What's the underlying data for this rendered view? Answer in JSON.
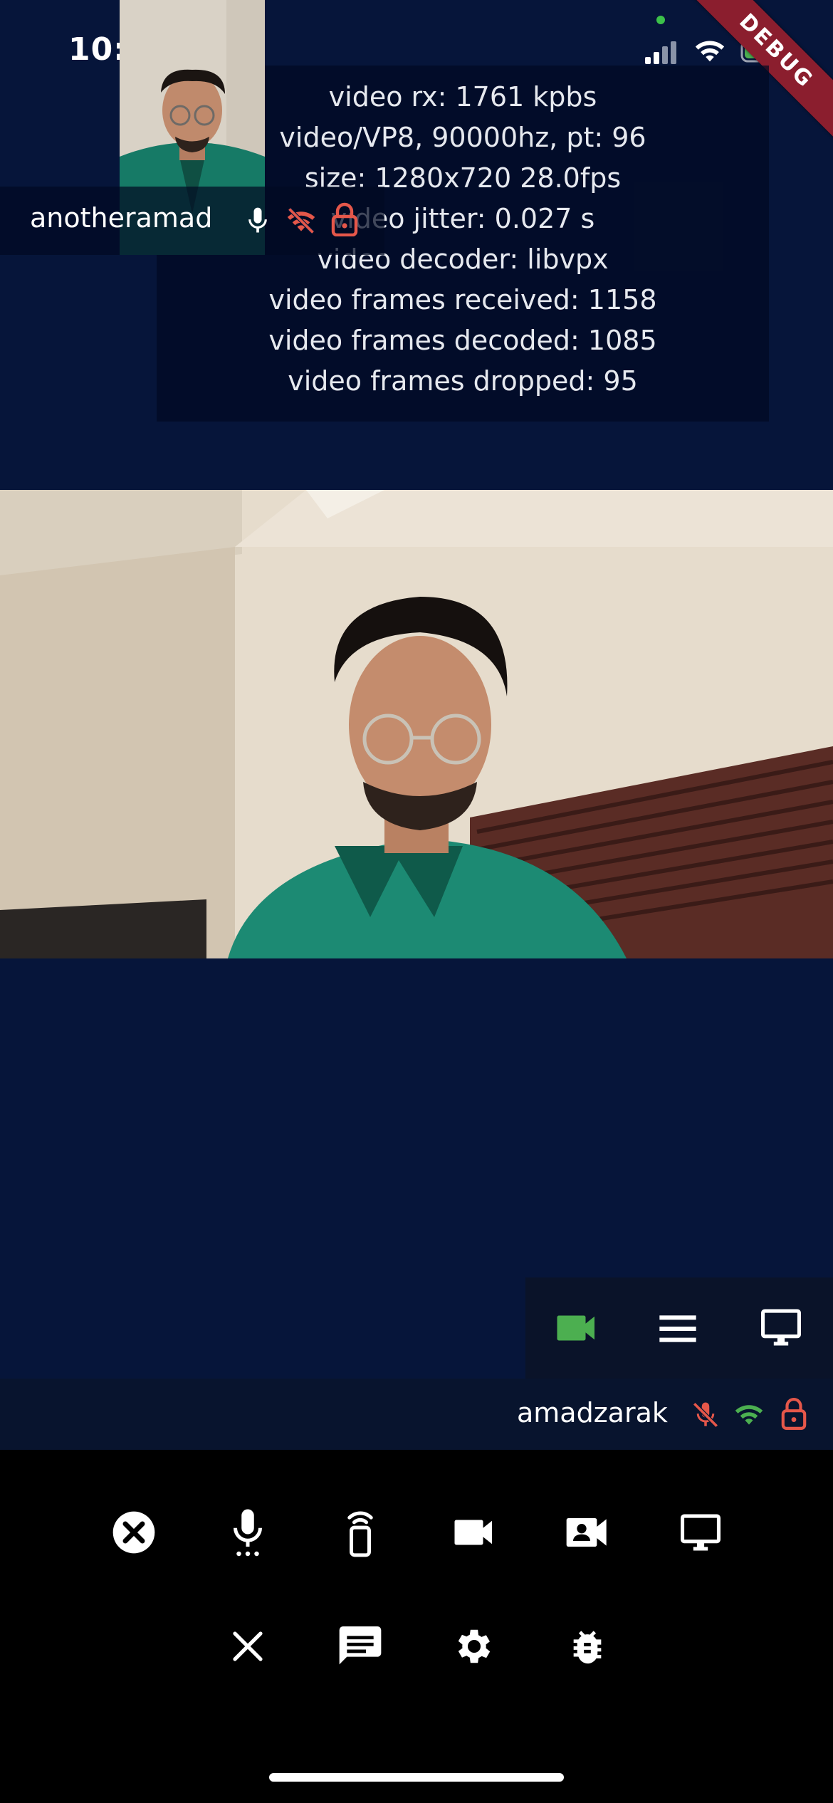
{
  "status_bar": {
    "time": "10:27",
    "icons": [
      "signal-icon",
      "wifi-icon",
      "battery-charging-icon"
    ]
  },
  "debug_banner": "DEBUG",
  "stats": {
    "lines": [
      "video rx: 1761 kpbs",
      "video/VP8, 90000hz, pt: 96",
      "size: 1280x720 28.0fps",
      "video jitter: 0.027 s",
      "video decoder: libvpx",
      "video frames received: 1158",
      "video frames decoded: 1085",
      "video frames dropped: 95"
    ]
  },
  "remote_participant": {
    "name": "anotheramad",
    "icons": [
      "mic-icon",
      "wifi-off-icon",
      "lock-open-icon"
    ]
  },
  "local_participant": {
    "name": "amadzarak",
    "icons": [
      "mic-off-icon",
      "wifi-icon",
      "lock-open-icon"
    ]
  },
  "view_switcher": {
    "items": [
      "videocam-icon",
      "menu-icon",
      "monitor-icon"
    ]
  },
  "controls": {
    "row1": [
      "close-circle-icon",
      "mic-icon",
      "speakerphone-icon",
      "videocam-icon",
      "switch-camera-icon",
      "screen-share-icon"
    ],
    "row2": [
      "close-icon",
      "chat-icon",
      "settings-icon",
      "debug-bug-icon"
    ]
  },
  "colors": {
    "background": "#06153a",
    "accent_green": "#4caf50",
    "warning_red": "#e5574a",
    "debug_banner": "#8b1e2e"
  }
}
